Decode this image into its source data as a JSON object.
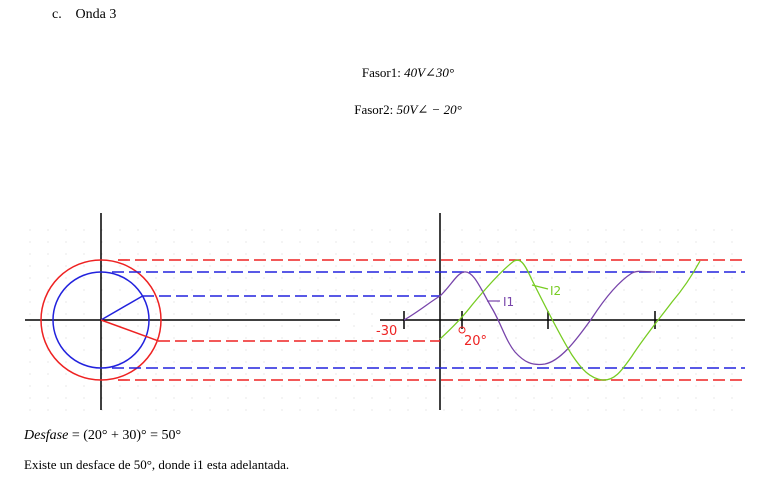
{
  "heading": {
    "label": "c.",
    "title": "Onda 3"
  },
  "phasor1": {
    "prefix": "Fasor1: ",
    "value": "40V∠30°"
  },
  "phasor2": {
    "prefix": "Fasor2: ",
    "value": "50V∠ − 20°"
  },
  "diagram": {
    "phasors": [
      {
        "name": "Fasor1",
        "magnitude": 40,
        "angle_deg": 30,
        "color": "#2222dd"
      },
      {
        "name": "Fasor2",
        "magnitude": 50,
        "angle_deg": -20,
        "color": "#ee2222"
      }
    ],
    "annotations": {
      "minus30": "-30",
      "plus20": "20°",
      "i1": "I1",
      "i2": "I2"
    },
    "colors": {
      "blue": "#2222dd",
      "red": "#ee2222",
      "purple": "#7744aa",
      "green": "#77cc22"
    }
  },
  "desfase": {
    "lhs": "Desfase",
    "rhs": " = (20° + 30)° = 50°"
  },
  "conclusion": "Existe un desface de 50°, donde i1 esta adelantada."
}
